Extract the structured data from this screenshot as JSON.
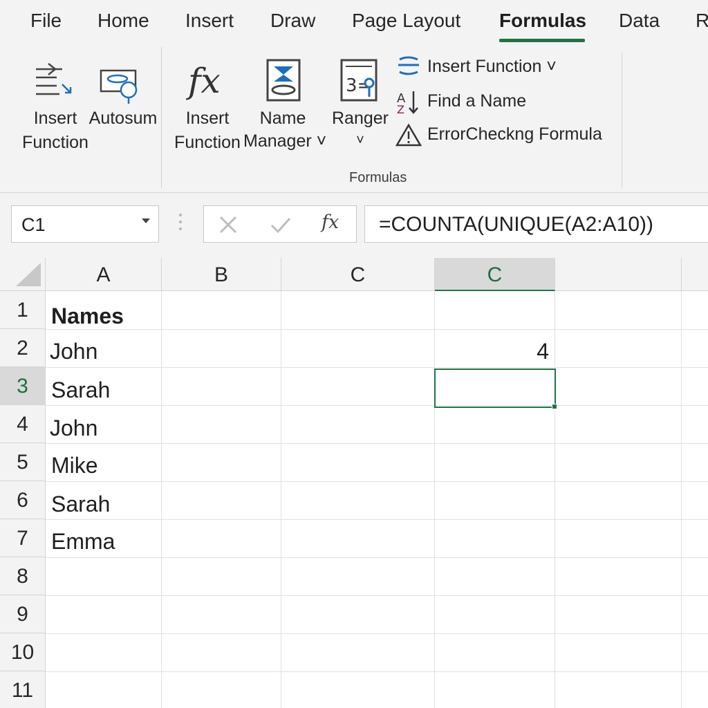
{
  "tabs": [
    "File",
    "Home",
    "Insert",
    "Draw",
    "Page Layout",
    "Formulas",
    "Data",
    "R"
  ],
  "active_tab": "Formulas",
  "ribbon": {
    "insert_function_left": {
      "line1": "Insert",
      "line2": "Function"
    },
    "autosum": {
      "label": "Autosum"
    },
    "insert_function": {
      "line1": "Insert",
      "line2": "Function"
    },
    "name_manager": {
      "line1": "Name",
      "line2": "Manager ˅"
    },
    "ranger": {
      "line1": "Ranger",
      "line2": "˅"
    },
    "small_insert_function": "Insert Function ˅",
    "find_a_name": "Find a Name",
    "error_checking": "ErrorCheckng Formula",
    "group_label": "Formulas"
  },
  "formula_bar": {
    "name_box": "C1",
    "fx": "fx",
    "formula": "=COUNTA(UNIQUE(A2:A10))"
  },
  "grid": {
    "columns": [
      "A",
      "B",
      "C",
      "C"
    ],
    "selected_column": "C",
    "rows": [
      "1",
      "2",
      "3",
      "4",
      "5",
      "6",
      "7",
      "8",
      "9",
      "10",
      "11"
    ],
    "selected_row": "3",
    "cells": {
      "A1": "Names",
      "A2": "John",
      "A3": "Sarah",
      "A4": "John",
      "A5": "Mike",
      "A6": "Sarah",
      "A7": "Emma",
      "D2": "4"
    }
  },
  "colors": {
    "accent": "#217346",
    "ribbon_bg": "#f3f3f3",
    "header_selected_bg": "#d9d9d9",
    "icon_blue": "#1f6fb5"
  },
  "icons": {
    "insert_function_left": "insert-function-icon",
    "autosum": "autosum-icon",
    "insert_function": "fx-icon",
    "name_manager": "name-manager-icon",
    "ranger": "ranger-icon",
    "small_insert_function": "insert-function-small-icon",
    "find_a_name": "find-name-icon",
    "error_checking": "warning-icon",
    "cancel": "close-icon",
    "enter": "check-icon"
  }
}
